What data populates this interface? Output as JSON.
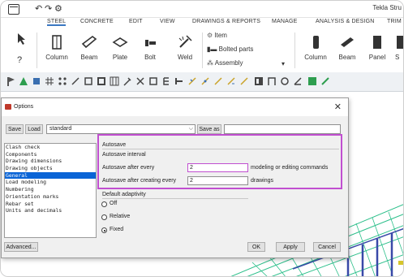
{
  "app": {
    "title_fragment": "Tekla Stru"
  },
  "ribbon_tabs": [
    "STEEL",
    "CONCRETE",
    "EDIT",
    "VIEW",
    "DRAWINGS & REPORTS",
    "MANAGE",
    "ANALYSIS & DESIGN",
    "TRIM"
  ],
  "ribbon_buttons": {
    "column": "Column",
    "beam": "Beam",
    "plate": "Plate",
    "bolt": "Bolt",
    "weld": "Weld",
    "item": "Item",
    "bolted_parts": "Bolted parts",
    "assembly": "Assembly",
    "column2": "Column",
    "beam2": "Beam",
    "panel": "Panel",
    "more": "S"
  },
  "dialog": {
    "title": "Options",
    "save": "Save",
    "load": "Load",
    "settings_value": "standard",
    "save_as": "Save as",
    "save_as_value": "",
    "categories": [
      "Clash check",
      "Components",
      "Drawing dimensions",
      "Drawing objects",
      "General",
      "Load modeling",
      "Numbering",
      "Orientation marks",
      "Rebar set",
      "Units and decimals"
    ],
    "selected_category": "General",
    "autosave_heading": "Autosave",
    "autosave_interval": "Autosave interval",
    "after_every_label": "Autosave after every",
    "after_every_value": "2",
    "after_every_unit": "modeling or editing commands",
    "after_creating_label": "Autosave after creating every",
    "after_creating_value": "2",
    "after_creating_unit": "drawings",
    "adaptivity_heading": "Default adaptivity",
    "adaptivity_options": [
      "Off",
      "Relative",
      "Fixed"
    ],
    "adaptivity_selected": "Fixed",
    "advanced": "Advanced...",
    "ok": "OK",
    "apply": "Apply",
    "cancel": "Cancel"
  },
  "colors": {
    "accent": "#3b78c2",
    "highlight": "#c14fd0",
    "selection": "#0a64d6",
    "model_green": "#2bbf8a",
    "model_blue": "#3949a8"
  }
}
